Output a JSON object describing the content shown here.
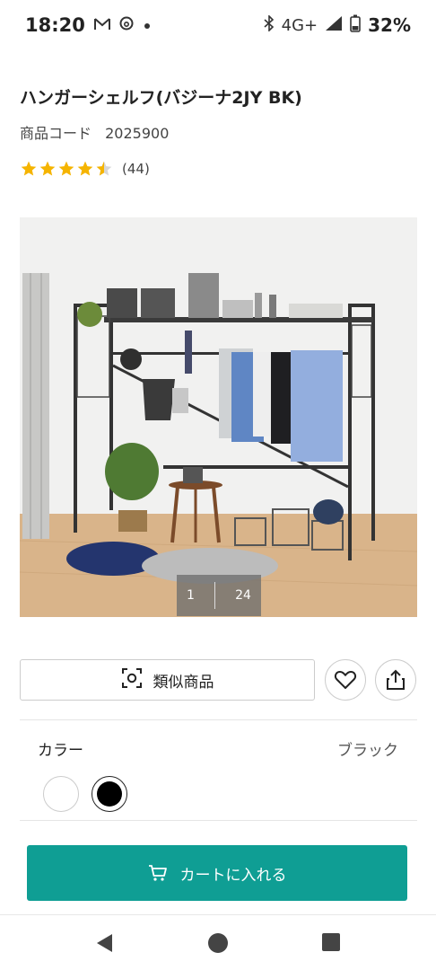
{
  "status_bar": {
    "time": "18:20",
    "network": "4G+",
    "battery": "32%"
  },
  "product": {
    "title": "ハンガーシェルフ(バジーナ2JY BK)",
    "code_label": "商品コード",
    "code_value": "2025900",
    "rating_value": 4.5,
    "rating_count": "(44)"
  },
  "gallery": {
    "current": "1",
    "total": "24"
  },
  "actions": {
    "similar_label": "類似商品"
  },
  "color": {
    "label": "カラー",
    "selected": "ブラック",
    "swatches": [
      "#ffffff",
      "#000000"
    ]
  },
  "cart": {
    "label": "カートに入れる"
  },
  "colors": {
    "accent": "#0f9e94",
    "star": "#f5b400"
  }
}
